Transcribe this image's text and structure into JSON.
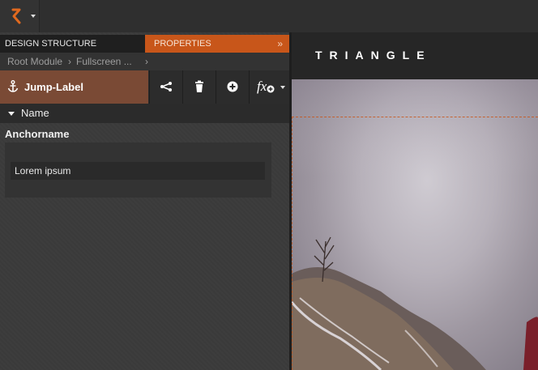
{
  "toolbar": {
    "logo_icon": "brand-logo-icon"
  },
  "tabs": {
    "design_structure": "DESIGN STRUCTURE",
    "properties": "PROPERTIES",
    "collapse_glyph": "»"
  },
  "breadcrumb": {
    "items": [
      "Root Module",
      "Fullscreen ..."
    ],
    "separator": "›"
  },
  "element": {
    "name": "Jump-Label",
    "icon": "anchor-icon",
    "actions": [
      "share-icon",
      "trash-icon",
      "add-icon",
      "function-icon"
    ]
  },
  "section": {
    "title": "Name"
  },
  "field": {
    "label": "Anchorname",
    "value": "Lorem ipsum"
  },
  "preview": {
    "brand": "TRIANGLE"
  },
  "colors": {
    "accent": "#c8561a",
    "element_bg": "#7a4a35",
    "panel_bg": "#3b3b3b"
  }
}
